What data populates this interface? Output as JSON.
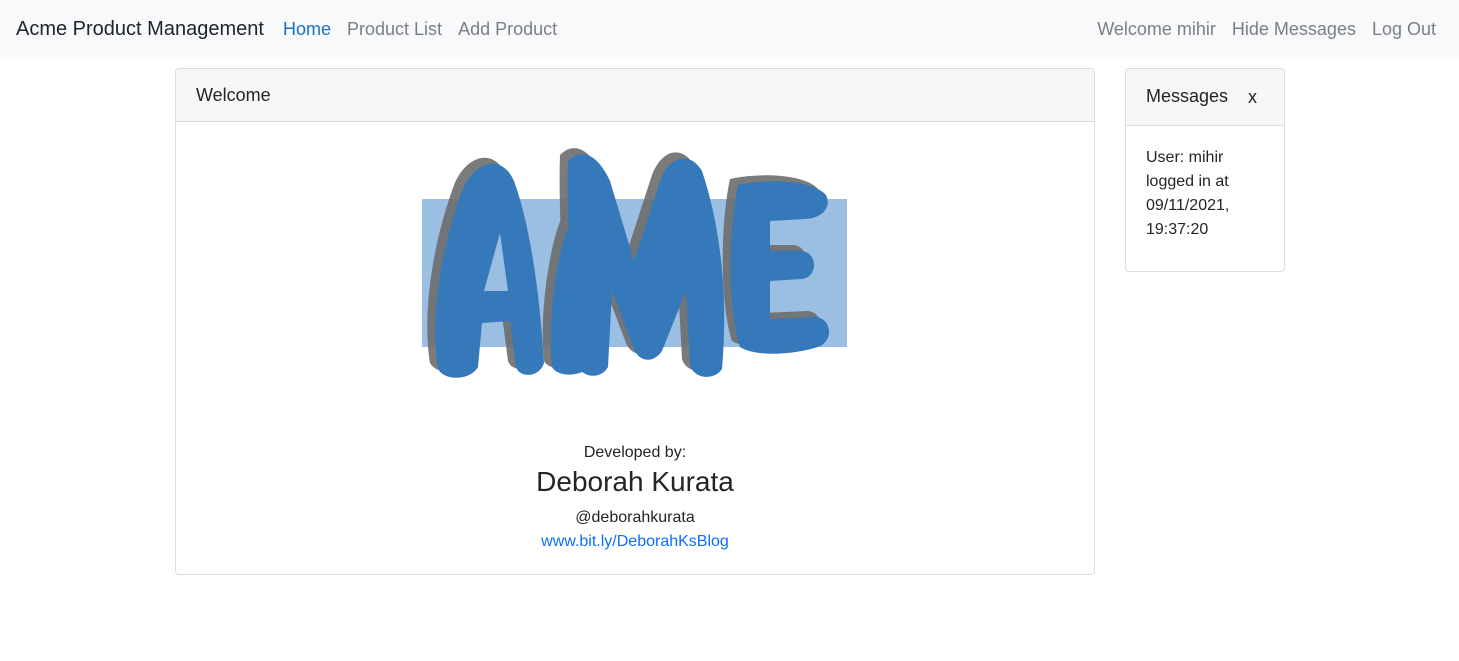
{
  "navbar": {
    "brand": "Acme Product Management",
    "links": [
      {
        "label": "Home",
        "active": true
      },
      {
        "label": "Product List",
        "active": false
      },
      {
        "label": "Add Product",
        "active": false
      }
    ],
    "right_links": [
      {
        "label": "Welcome mihir"
      },
      {
        "label": "Hide Messages"
      },
      {
        "label": "Log Out"
      }
    ]
  },
  "welcome": {
    "header": "Welcome",
    "logo_text": "ACME",
    "developed_label": "Developed by:",
    "developer_name": "Deborah Kurata",
    "handle": "@deborahkurata",
    "blog_link": "www.bit.ly/DeborahKsBlog"
  },
  "messages": {
    "header": "Messages",
    "close_label": "x",
    "body": "User: mihir logged in at 09/11/2021, 19:37:20"
  },
  "colors": {
    "accent": "#1a6fc4",
    "logo_blue": "#3579bb",
    "logo_box": "#9bbfe3",
    "logo_shadow": "#6d6d6d",
    "navbar_bg": "#f8f9fa"
  }
}
